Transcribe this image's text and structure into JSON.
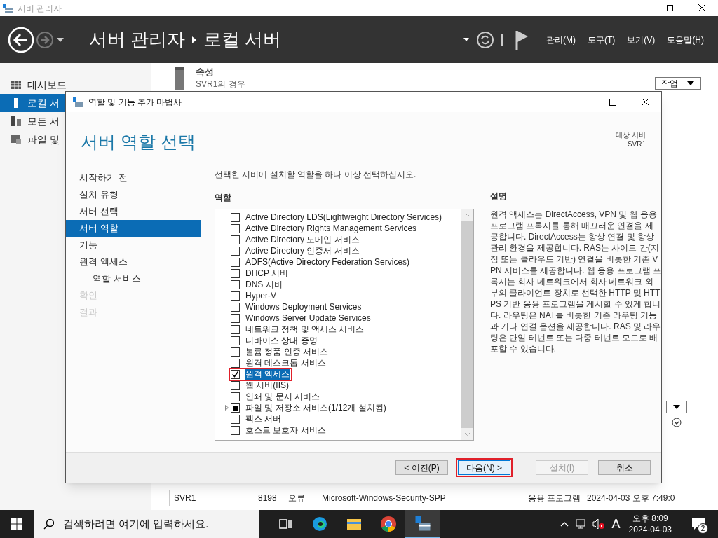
{
  "window": {
    "title": "서버 관리자"
  },
  "header": {
    "breadcrumb": [
      "서버 관리자",
      "로컬 서버"
    ],
    "menus": [
      "관리(M)",
      "도구(T)",
      "보기(V)",
      "도움말(H)"
    ]
  },
  "sidebar": {
    "items": [
      {
        "label": "대시보드",
        "kind": "dashboard",
        "selected": false
      },
      {
        "label": "로컬 서",
        "kind": "server",
        "selected": true
      },
      {
        "label": "모든 서",
        "kind": "servers",
        "selected": false
      },
      {
        "label": "파일 및",
        "kind": "files",
        "selected": false
      }
    ]
  },
  "properties": {
    "title": "속성",
    "subtitle": "SVR1의 경우",
    "tasks_button": "작업"
  },
  "events": {
    "rows": [
      {
        "server": "SVR1",
        "id": "8198",
        "level": "오류",
        "source": "Microsoft-Windows-Security-SPP",
        "log": "응용 프로그램",
        "time": "2024-04-03 오후 7:49:0"
      }
    ]
  },
  "dialog": {
    "title": "역할 및 기능 추가 마법사",
    "heading": "서버 역할 선택",
    "target_label": "대상 서버",
    "target_server": "SVR1",
    "steps": [
      {
        "label": "시작하기 전",
        "selected": false,
        "disabled": false
      },
      {
        "label": "설치 유형",
        "selected": false,
        "disabled": false
      },
      {
        "label": "서버 선택",
        "selected": false,
        "disabled": false
      },
      {
        "label": "서버 역할",
        "selected": true,
        "disabled": false
      },
      {
        "label": "기능",
        "selected": false,
        "disabled": false
      },
      {
        "label": "원격 액세스",
        "selected": false,
        "disabled": false,
        "children": [
          {
            "label": "역할 서비스",
            "selected": false,
            "disabled": false
          }
        ]
      },
      {
        "label": "확인",
        "selected": false,
        "disabled": true
      },
      {
        "label": "결과",
        "selected": false,
        "disabled": true
      }
    ],
    "instruction": "선택한 서버에 설치할 역할을 하나 이상 선택하십시오.",
    "roles_label": "역할",
    "roles": [
      {
        "label": "Active Directory LDS(Lightweight Directory Services)",
        "checked": false,
        "partial": false,
        "expandable": false,
        "selected": false,
        "highlighted": false
      },
      {
        "label": "Active Directory Rights Management Services",
        "checked": false,
        "partial": false,
        "expandable": false,
        "selected": false,
        "highlighted": false
      },
      {
        "label": "Active Directory 도메인 서비스",
        "checked": false,
        "partial": false,
        "expandable": false,
        "selected": false,
        "highlighted": false
      },
      {
        "label": "Active Directory 인증서 서비스",
        "checked": false,
        "partial": false,
        "expandable": false,
        "selected": false,
        "highlighted": false
      },
      {
        "label": "ADFS(Active Directory Federation Services)",
        "checked": false,
        "partial": false,
        "expandable": false,
        "selected": false,
        "highlighted": false
      },
      {
        "label": "DHCP 서버",
        "checked": false,
        "partial": false,
        "expandable": false,
        "selected": false,
        "highlighted": false
      },
      {
        "label": "DNS 서버",
        "checked": false,
        "partial": false,
        "expandable": false,
        "selected": false,
        "highlighted": false
      },
      {
        "label": "Hyper-V",
        "checked": false,
        "partial": false,
        "expandable": false,
        "selected": false,
        "highlighted": false
      },
      {
        "label": "Windows Deployment Services",
        "checked": false,
        "partial": false,
        "expandable": false,
        "selected": false,
        "highlighted": false
      },
      {
        "label": "Windows Server Update Services",
        "checked": false,
        "partial": false,
        "expandable": false,
        "selected": false,
        "highlighted": false
      },
      {
        "label": "네트워크 정책 및 액세스 서비스",
        "checked": false,
        "partial": false,
        "expandable": false,
        "selected": false,
        "highlighted": false
      },
      {
        "label": "디바이스 상태 증명",
        "checked": false,
        "partial": false,
        "expandable": false,
        "selected": false,
        "highlighted": false
      },
      {
        "label": "볼륨 정품 인증 서비스",
        "checked": false,
        "partial": false,
        "expandable": false,
        "selected": false,
        "highlighted": false
      },
      {
        "label": "원격 데스크톱 서비스",
        "checked": false,
        "partial": false,
        "expandable": false,
        "selected": false,
        "highlighted": false
      },
      {
        "label": "원격 액세스",
        "checked": true,
        "partial": false,
        "expandable": false,
        "selected": true,
        "highlighted": true
      },
      {
        "label": "웹 서버(IIS)",
        "checked": false,
        "partial": false,
        "expandable": false,
        "selected": false,
        "highlighted": false
      },
      {
        "label": "인쇄 및 문서 서비스",
        "checked": false,
        "partial": false,
        "expandable": false,
        "selected": false,
        "highlighted": false
      },
      {
        "label": "파일 및 저장소 서비스(1/12개 설치됨)",
        "checked": false,
        "partial": true,
        "expandable": true,
        "selected": false,
        "highlighted": false
      },
      {
        "label": "팩스 서버",
        "checked": false,
        "partial": false,
        "expandable": false,
        "selected": false,
        "highlighted": false
      },
      {
        "label": "호스트 보호자 서비스",
        "checked": false,
        "partial": false,
        "expandable": false,
        "selected": false,
        "highlighted": false
      }
    ],
    "description_label": "설명",
    "description": "원격 액세스는 DirectAccess, VPN 및 웹 응용 프로그램 프록시를 통해 매끄러운 연결을 제공합니다. DirectAccess는 항상 연결 및 항상 관리 환경을 제공합니다. RAS는 사이트 간(지점 또는 클라우드 기반) 연결을 비롯한 기존 VPN 서비스를 제공합니다. 웹 응용 프로그램 프록시는 회사 네트워크에서 회사 네트워크 외부의 클라이언트 장치로 선택한 HTTP 및 HTTPS 기반 응용 프로그램을 게시할 수 있게 합니다. 라우팅은 NAT를 비롯한 기존 라우팅 기능과 기타 연결 옵션을 제공합니다. RAS 및 라우팅은 단일 테넌트 또는 다중 테넌트 모드로 배포할 수 있습니다.",
    "buttons": [
      {
        "label": "< 이전(P)",
        "kind": "previous",
        "disabled": false,
        "focused": false,
        "highlighted": false
      },
      {
        "label": "다음(N) >",
        "kind": "next",
        "disabled": false,
        "focused": true,
        "highlighted": true
      },
      {
        "label": "설치(I)",
        "kind": "install",
        "disabled": true,
        "focused": false,
        "highlighted": false
      },
      {
        "label": "취소",
        "kind": "cancel",
        "disabled": false,
        "focused": false,
        "highlighted": false
      }
    ]
  },
  "taskbar": {
    "search_placeholder": "검색하려면 여기에 입력하세요.",
    "apps": [
      {
        "kind": "taskview",
        "active": false
      },
      {
        "kind": "edge",
        "active": false
      },
      {
        "kind": "explorer",
        "active": false
      },
      {
        "kind": "chrome",
        "active": false
      },
      {
        "kind": "servermanager",
        "active": true
      }
    ],
    "input_mode": "A",
    "time": "오후 8:09",
    "date": "2024-04-03",
    "notifications": "2"
  }
}
